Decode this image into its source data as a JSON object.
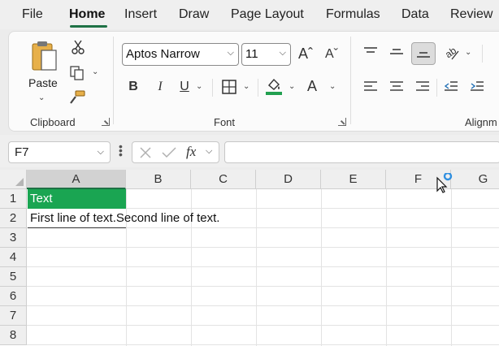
{
  "menu": {
    "tabs": [
      {
        "label": "File"
      },
      {
        "label": "Home"
      },
      {
        "label": "Insert"
      },
      {
        "label": "Draw"
      },
      {
        "label": "Page Layout"
      },
      {
        "label": "Formulas"
      },
      {
        "label": "Data"
      },
      {
        "label": "Review"
      }
    ],
    "active": "Home"
  },
  "ribbon": {
    "clipboard": {
      "paste_label": "Paste",
      "group_label": "Clipboard"
    },
    "font": {
      "font_name": "Aptos Narrow",
      "font_size": "11",
      "group_label": "Font",
      "fill_color": "#22a050"
    },
    "alignment": {
      "group_label": "Alignm"
    }
  },
  "formula_bar": {
    "name_box": "F7",
    "fx": "fx",
    "formula": ""
  },
  "sheet": {
    "columns": [
      "A",
      "B",
      "C",
      "D",
      "E",
      "F",
      "G"
    ],
    "rows": [
      "1",
      "2",
      "3",
      "4",
      "5",
      "6",
      "7",
      "8"
    ],
    "cells": {
      "A1": "Text",
      "A2": "First line of text.Second line of text."
    },
    "colors": {
      "a1_fill": "#1aa552",
      "accent": "#1e7145"
    }
  }
}
